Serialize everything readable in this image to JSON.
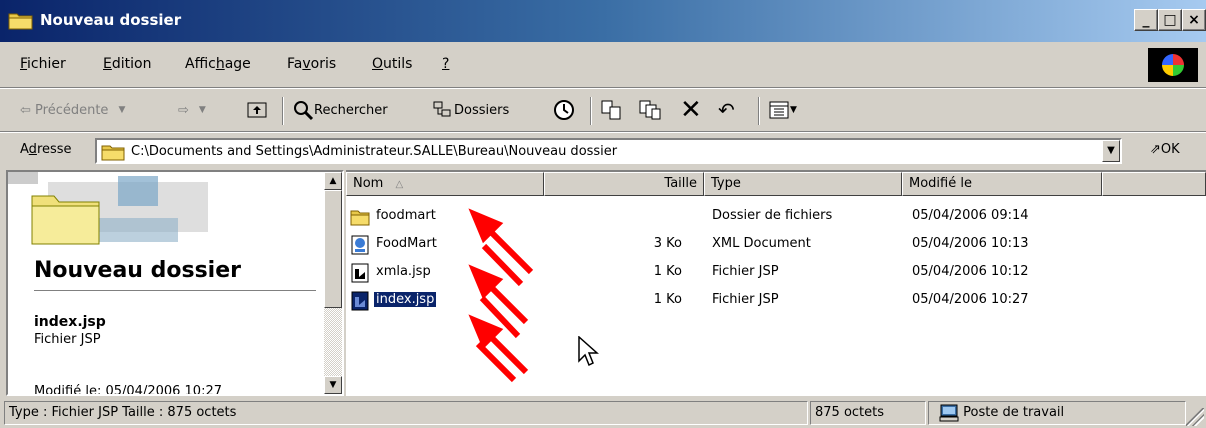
{
  "window": {
    "title": "Nouveau dossier"
  },
  "menu": {
    "items": [
      {
        "pre": "",
        "ul": "F",
        "post": "ichier"
      },
      {
        "pre": "",
        "ul": "E",
        "post": "dition"
      },
      {
        "pre": "Affic",
        "ul": "h",
        "post": "age"
      },
      {
        "pre": "Fa",
        "ul": "v",
        "post": "oris"
      },
      {
        "pre": "",
        "ul": "O",
        "post": "utils"
      },
      {
        "pre": "",
        "ul": "?",
        "post": ""
      }
    ]
  },
  "toolbar": {
    "back_label": "Précédente",
    "search_label": "Rechercher",
    "folders_label": "Dossiers"
  },
  "address": {
    "label_pre": "A",
    "label_ul": "d",
    "label_post": "resse",
    "path": "C:\\Documents and Settings\\Administrateur.SALLE\\Bureau\\Nouveau dossier",
    "go_label": "OK"
  },
  "left_pane": {
    "heading": "Nouveau dossier",
    "selected_name": "index.jsp",
    "selected_type": "Fichier JSP",
    "modified_partial": "Modifié le: 05/04/2006 10:27"
  },
  "list": {
    "columns": [
      "Nom",
      "Taille",
      "Type",
      "Modifié le"
    ],
    "rows": [
      {
        "name": "foodmart",
        "size": "",
        "type": "Dossier de fichiers",
        "modified": "05/04/2006 09:14",
        "icon": "folder-icon"
      },
      {
        "name": "FoodMart",
        "size": "3 Ko",
        "type": "XML Document",
        "modified": "05/04/2006 10:13",
        "icon": "xml-file-icon"
      },
      {
        "name": "xmla.jsp",
        "size": "1 Ko",
        "type": "Fichier JSP",
        "modified": "05/04/2006 10:12",
        "icon": "jsp-file-icon"
      },
      {
        "name": "index.jsp",
        "size": "1 Ko",
        "type": "Fichier JSP",
        "modified": "05/04/2006 10:27",
        "icon": "jsp-file-icon",
        "selected": true
      }
    ]
  },
  "status": {
    "info": "Type : Fichier JSP Taille : 875 octets",
    "size": "875 octets",
    "zone": "Poste de travail"
  },
  "colors": {
    "arrow": "#ff0000",
    "selection": "#0a246a"
  }
}
